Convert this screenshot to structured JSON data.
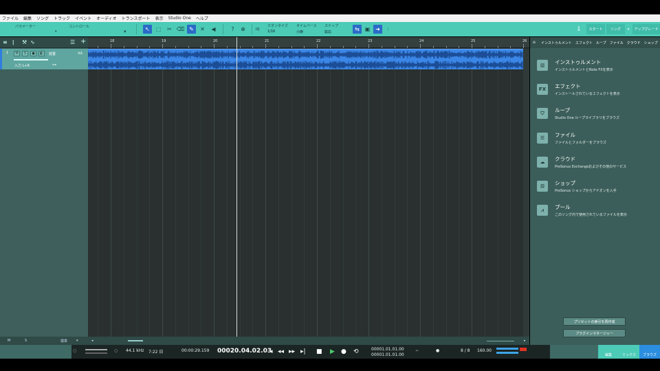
{
  "menu": [
    "ファイル",
    "編集",
    "ソング",
    "トラック",
    "イベント",
    "オーディオ",
    "トランスポート",
    "表示",
    "Studio One",
    "ヘルプ"
  ],
  "toolbar": {
    "parameter_label": "パラメーター",
    "control_label": "コントロール",
    "quantize_label": "クオンタイズ",
    "quantize_value": "1/16",
    "timebase_label": "タイムベース",
    "timebase_value": "小節",
    "snap_label": "スナップ",
    "snap_value": "拡応",
    "iq_label": "IQ",
    "start_label": "スタート",
    "song_label": "ソング",
    "upgrade_label": "アップグレード"
  },
  "track": {
    "number": "1",
    "mute": "M",
    "solo": "S",
    "name": "放置",
    "input": "入力 L+R"
  },
  "ruler": [
    "18",
    "19",
    "20",
    "21",
    "22",
    "23",
    "24",
    "25",
    "26"
  ],
  "strip": {
    "m": "M",
    "s": "S",
    "standard": "標準"
  },
  "browser": {
    "tabs": [
      "インストゥルメント",
      "エフェクト",
      "ループ",
      "ファイル",
      "クラウド",
      "ショップ",
      "プ"
    ],
    "items": [
      {
        "icon": "piano-icon",
        "title": "インストゥルメント",
        "desc": "インストゥルメントとNote FXを表示"
      },
      {
        "icon": "fx-icon",
        "icon_text": "FX",
        "title": "エフェクト",
        "desc": "インストールされているエフェクトを表示"
      },
      {
        "icon": "loop-icon",
        "title": "ループ",
        "desc": "Studio One ループライブラリをブラウズ"
      },
      {
        "icon": "file-icon",
        "title": "ファイル",
        "desc": "ファイルとフォルダーをブラウズ"
      },
      {
        "icon": "cloud-icon",
        "title": "クラウド",
        "desc": "PreSonus Exchangeおよびその他のサービス"
      },
      {
        "icon": "shop-icon",
        "title": "ショップ",
        "desc": "PreSonus ショップからアドオンを入手"
      },
      {
        "icon": "pool-icon",
        "title": "プール",
        "desc": "このソング内で使用されているファイルを表示"
      }
    ],
    "rebuild_label": "プリセットの索引を再作成",
    "plugin_manager_label": "プラグインマネージャー"
  },
  "transport": {
    "sample_rate": "44.1 kHz",
    "duration": "7:22 日",
    "time": "00:00:29.159",
    "position": "00020.04.02.03",
    "loop_start": "00001.01.01.00",
    "loop_end": "00001.01.01.00",
    "signature": "8 / 8",
    "tempo": "160.00"
  },
  "pages": [
    {
      "label": "編集",
      "active": false
    },
    {
      "label": "ミックス",
      "active": false
    },
    {
      "label": "ブラウズ",
      "active": true
    }
  ],
  "colors": {
    "accent": "#4ccbb7",
    "event": "#3b87e8",
    "arrange_bg": "#29302f"
  }
}
